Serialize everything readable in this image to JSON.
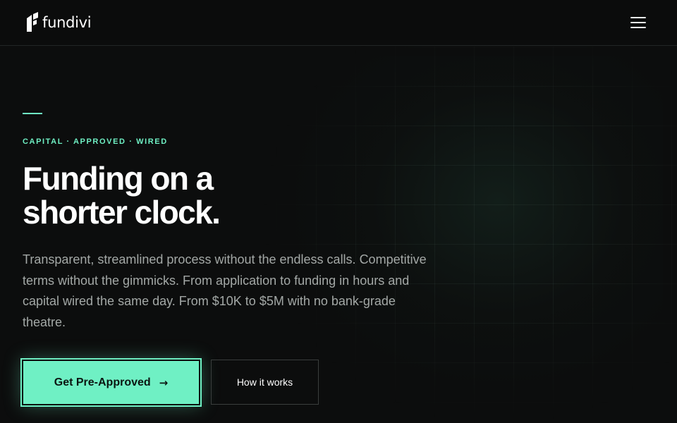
{
  "brand": {
    "name": "fundivi",
    "logo_icon": "fundivi-logo-mark"
  },
  "header": {
    "menu_icon": "hamburger-menu-icon"
  },
  "hero": {
    "eyebrow": "CAPITAL · APPROVED · WIRED",
    "headline_line1": "Funding on a",
    "headline_line2": "shorter clock.",
    "subtext": "Transparent, streamlined process without the endless calls. Competitive terms without the gimmicks. From application to funding in hours and capital wired the same day. From $10K to $5M with no bank-grade theatre."
  },
  "actions": {
    "primary_label": "Get Pre-Approved",
    "primary_icon": "arrow-right-icon",
    "primary_arrow": "→",
    "secondary_label": "How it works"
  },
  "colors": {
    "accent": "#6ff0c4",
    "background": "#0c0d0d",
    "text": "#ffffff",
    "muted_text": "#a3a8a6"
  }
}
